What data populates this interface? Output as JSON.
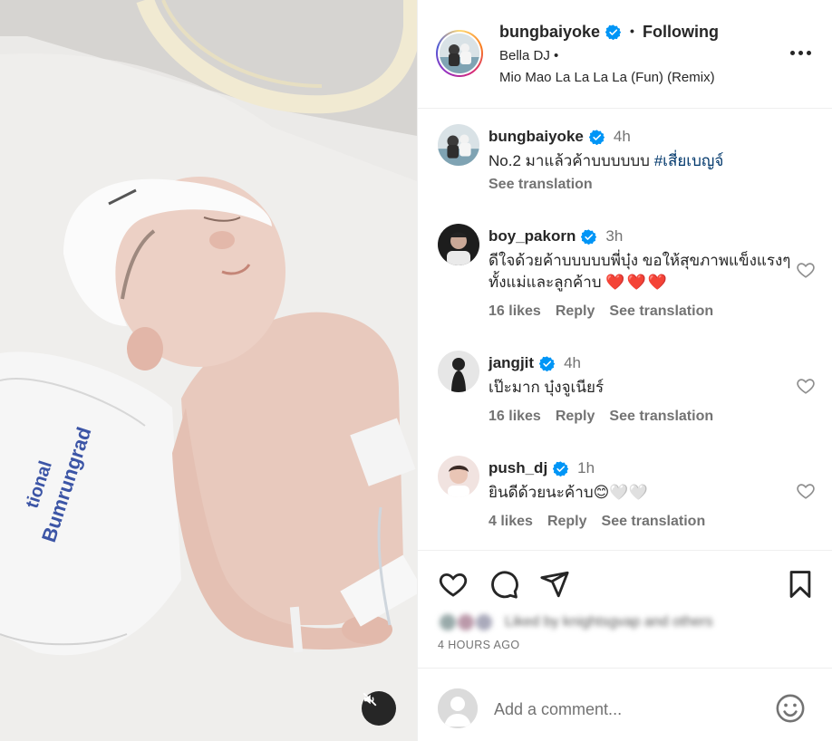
{
  "post": {
    "username": "bungbaiyoke",
    "follow_status": "Following",
    "separator": "•",
    "audio_artist": "Bella DJ •",
    "audio_track": "Mio Mao La La La La (Fun) (Remix)"
  },
  "caption": {
    "username": "bungbaiyoke",
    "time": "4h",
    "text_prefix": "No.2 มาแล้วค้าบบบบบบ ",
    "hashtag": "#เสี่ยเบญจ์",
    "see_translation": "See translation"
  },
  "comments": [
    {
      "username": "boy_pakorn",
      "time": "3h",
      "text": "ดีใจด้วยค้าบบบบบพี่บุ๋ง ขอให้สุขภาพแข็งแรงๆทั้งแม่และลูกค้าบ",
      "hearts": "❤️❤️❤️",
      "likes": "16 likes",
      "reply": "Reply",
      "see_translation": "See translation"
    },
    {
      "username": "jangjit",
      "time": "4h",
      "text": "เป๊ะมาก บุ๋งจูเนียร์",
      "likes": "16 likes",
      "reply": "Reply",
      "see_translation": "See translation"
    },
    {
      "username": "push_dj",
      "time": "1h",
      "text": "ยินดีด้วยนะค้าบ😊🤍🤍",
      "likes": "4 likes",
      "reply": "Reply",
      "see_translation": "See translation"
    }
  ],
  "liked_by_text": "Liked by knightsgvap and others",
  "posted_time": "4 HOURS AGO",
  "comment_box": {
    "placeholder": "Add a comment..."
  },
  "media": {
    "blanket_text": "Bumrungrad",
    "blanket_text2": "tional"
  },
  "colors": {
    "accent_link": "#00376b",
    "verified": "#0095f6",
    "heart_red": "#e0002b",
    "muted_text": "#737373"
  },
  "icons": [
    "verified-badge-icon",
    "more-options-icon",
    "heart-icon",
    "comment-icon",
    "share-icon",
    "save-icon",
    "emoji-icon",
    "audio-muted-icon"
  ]
}
